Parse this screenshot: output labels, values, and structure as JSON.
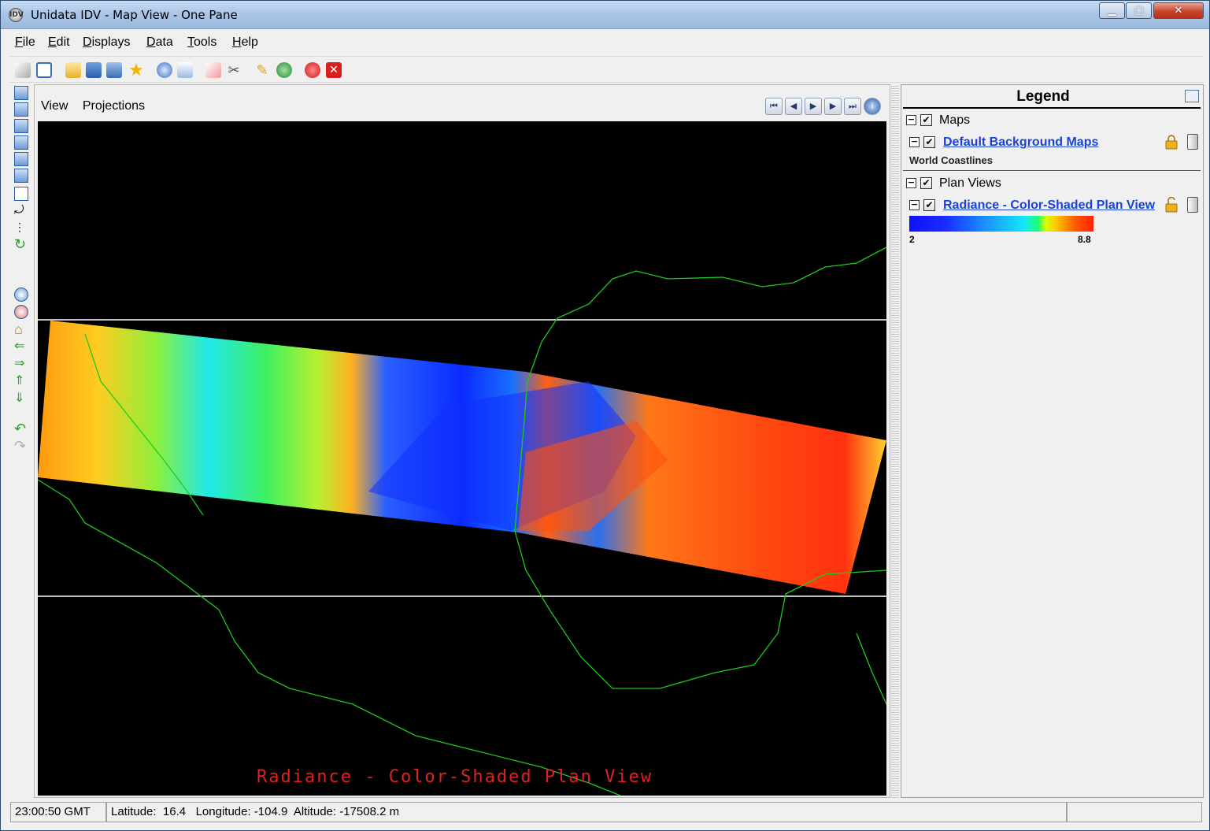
{
  "window": {
    "title": "Unidata IDV - Map View - One Pane",
    "buttons": [
      "minimize",
      "maximize",
      "close"
    ]
  },
  "menubar": {
    "items": [
      "File",
      "Edit",
      "Displays",
      "Data",
      "Tools",
      "Help"
    ]
  },
  "toolbar": {
    "icons": [
      "wand-icon",
      "new-window-icon",
      "open-folder-icon",
      "save-icon",
      "save-as-icon",
      "favorite-star-icon",
      "help-icon",
      "email-icon",
      "eraser-icon",
      "cut-icon",
      "edit-pencil-icon",
      "globe-icon",
      "record-icon",
      "stop-icon"
    ]
  },
  "view_menu": {
    "items": [
      "View",
      "Projections"
    ]
  },
  "animation": {
    "buttons": [
      "first",
      "step-back",
      "play",
      "step-forward",
      "last",
      "info"
    ]
  },
  "map": {
    "caption": "Radiance - Color-Shaded Plan View"
  },
  "legend": {
    "title": "Legend",
    "groups": [
      {
        "label": "Maps",
        "checked": true,
        "items": [
          {
            "label": "Default Background Maps",
            "sub": "World Coastlines",
            "checked": true
          }
        ]
      },
      {
        "label": "Plan Views",
        "checked": true,
        "items": [
          {
            "label": "Radiance - Color-Shaded Plan View",
            "checked": true
          }
        ]
      }
    ],
    "colorbar": {
      "min": "2",
      "max": "8.8"
    }
  },
  "status": {
    "time": "23:00:50 GMT",
    "location": "Latitude:  16.4   Longitude: -104.9  Altitude: -17508.2 m"
  }
}
